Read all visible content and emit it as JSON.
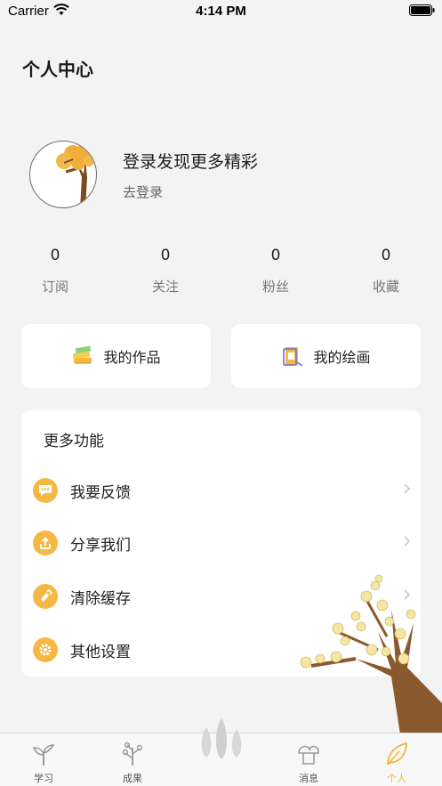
{
  "status_bar": {
    "carrier": "Carrier",
    "time": "4:14 PM"
  },
  "page": {
    "title": "个人中心"
  },
  "profile": {
    "login_title": "登录发现更多精彩",
    "login_link": "去登录"
  },
  "stats": [
    {
      "value": "0",
      "label": "订阅"
    },
    {
      "value": "0",
      "label": "关注"
    },
    {
      "value": "0",
      "label": "粉丝"
    },
    {
      "value": "0",
      "label": "收藏"
    }
  ],
  "works": {
    "my_works": {
      "label": "我的作品",
      "icon": "books-icon"
    },
    "my_paintings": {
      "label": "我的绘画",
      "icon": "painting-icon"
    }
  },
  "more": {
    "title": "更多功能",
    "items": [
      {
        "label": "我要反馈",
        "icon": "feedback-icon"
      },
      {
        "label": "分享我们",
        "icon": "share-icon"
      },
      {
        "label": "清除缓存",
        "icon": "clear-cache-icon"
      },
      {
        "label": "其他设置",
        "icon": "settings-icon"
      }
    ]
  },
  "tabbar": {
    "items": [
      {
        "label": "学习",
        "icon": "sprout-icon"
      },
      {
        "label": "成果",
        "icon": "plant-icon"
      },
      {
        "label": "消息",
        "icon": "mushroom-icon"
      },
      {
        "label": "个人",
        "icon": "leaf-icon"
      }
    ],
    "active_index": 3
  },
  "colors": {
    "accent": "#f6b844",
    "active_tab": "#f3b43a",
    "background": "#f3f3f3"
  }
}
